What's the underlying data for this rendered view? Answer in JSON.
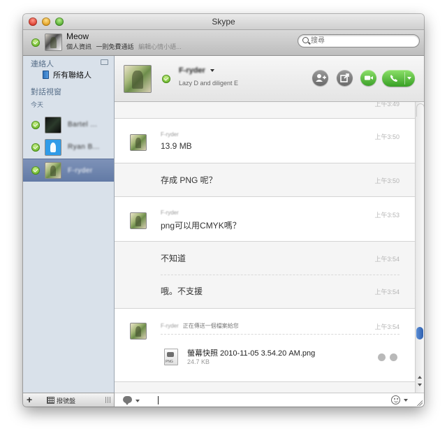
{
  "window": {
    "title": "Skype"
  },
  "me": {
    "name": "Meow",
    "profile_link": "個人資訊",
    "call_note": "一則免費通話",
    "mood_placeholder": "編輯心情小語..."
  },
  "search": {
    "placeholder": "搜尋"
  },
  "sidebar": {
    "contacts_header": "連絡人",
    "all_contacts": "所有聯絡人",
    "conversations_header": "對話視窗",
    "today_label": "今天",
    "conversations": [
      {
        "name": "Bartel ..."
      },
      {
        "name": "Ryan B..."
      },
      {
        "name": "F-ryder"
      }
    ],
    "dialpad_label": "撥號盤"
  },
  "chat": {
    "peer_name": "F-ryder",
    "peer_mood": "Lazy D and diligent E",
    "messages": [
      {
        "time": "上午3:49"
      },
      {
        "sender": "F-ryder",
        "text": "13.9 MB",
        "time": "上午3:50"
      },
      {
        "text": "存成 PNG 呢？",
        "time": "上午3:50"
      },
      {
        "sender": "F-ryder",
        "text": "png可以用CMYK嗎？",
        "time": "上午3:53"
      },
      {
        "text": "不知道",
        "time": "上午3:54"
      },
      {
        "text": "哦。不支援",
        "time": "上午3:54"
      },
      {
        "sender": "F-ryder",
        "note": "正在傳送一個檔案給您",
        "time": "上午3:54"
      }
    ],
    "file": {
      "name": "螢幕快照 2010-11-05 3.54.20 AM.png",
      "size": "24.7 KB",
      "icon_label": "PNG"
    }
  },
  "colors": {
    "accent_green": "#4ea82c",
    "sidebar_bg": "#d9e1ea",
    "selected_row": "#6b82ac"
  }
}
